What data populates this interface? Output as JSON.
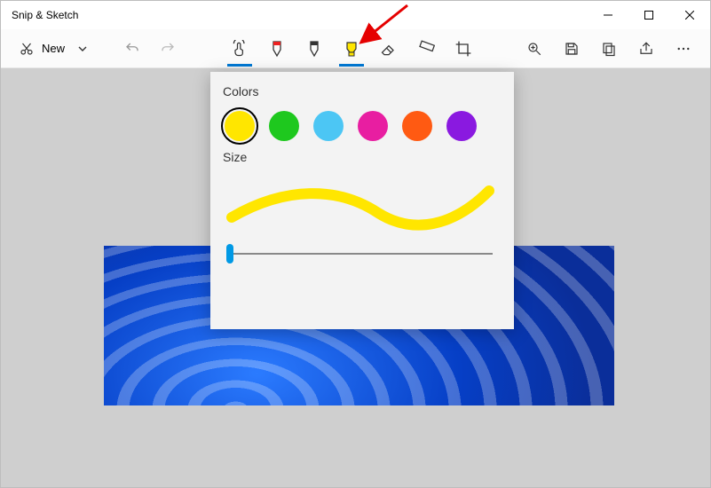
{
  "app": {
    "title": "Snip & Sketch"
  },
  "toolbar": {
    "new_label": "New"
  },
  "popup": {
    "colors_heading": "Colors",
    "size_heading": "Size",
    "colors": [
      {
        "name": "yellow",
        "hex": "#ffe600",
        "selected": true
      },
      {
        "name": "green",
        "hex": "#1ec81e",
        "selected": false
      },
      {
        "name": "skyblue",
        "hex": "#4cc6f4",
        "selected": false
      },
      {
        "name": "magenta",
        "hex": "#e81ea1",
        "selected": false
      },
      {
        "name": "orange",
        "hex": "#ff5a12",
        "selected": false
      },
      {
        "name": "purple",
        "hex": "#8a19e0",
        "selected": false
      }
    ],
    "slider_value": 0
  }
}
